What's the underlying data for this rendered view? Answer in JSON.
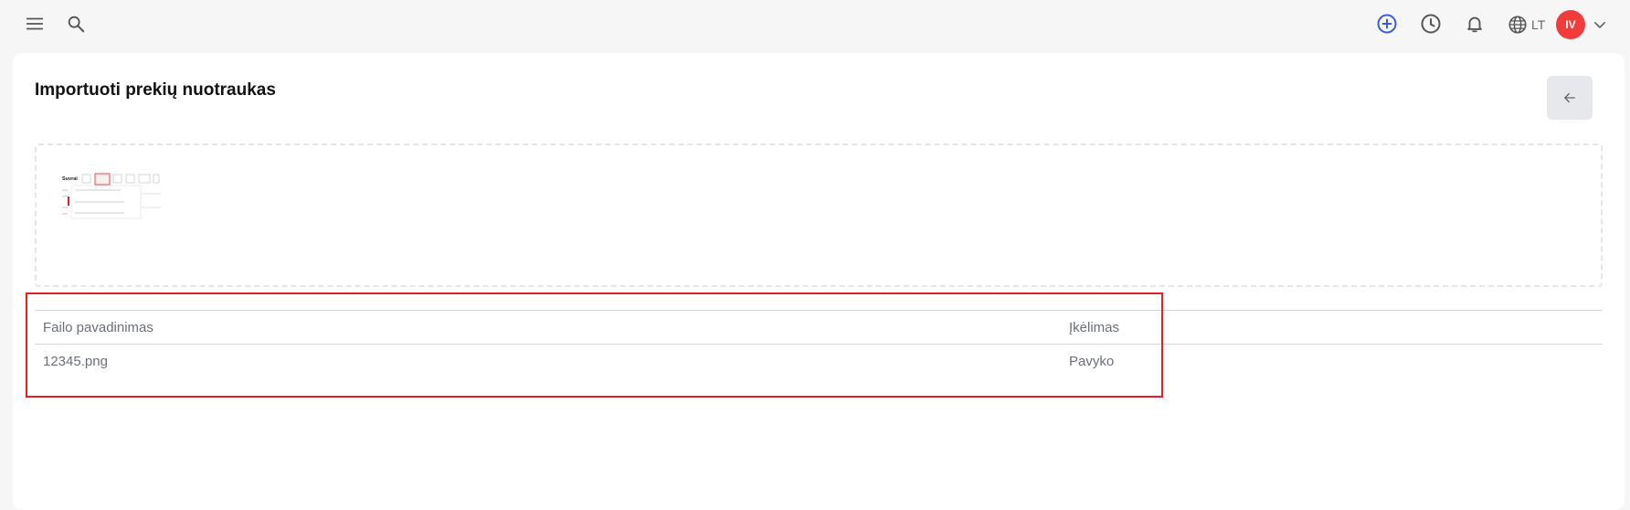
{
  "topbar": {
    "language": "LT",
    "avatar_initials": "IV",
    "accent_color": "#3b5bdb",
    "avatar_color": "#f23c3c"
  },
  "page": {
    "title": "Importuoti prekių nuotraukas"
  },
  "thumbnail": {
    "label": "Suvrai"
  },
  "table": {
    "columns": [
      "Failo pavadinimas",
      "Įkėlimas"
    ],
    "rows": [
      [
        "12345.png",
        "Pavyko"
      ]
    ]
  },
  "icons": {
    "menu": "menu-icon",
    "search": "search-icon",
    "add": "plus-circle-icon",
    "history": "clock-icon",
    "notifications": "bell-icon",
    "language": "globe-icon",
    "account": "chevron-down-icon",
    "back": "arrow-left-icon"
  },
  "highlight_color": "#e0202a"
}
